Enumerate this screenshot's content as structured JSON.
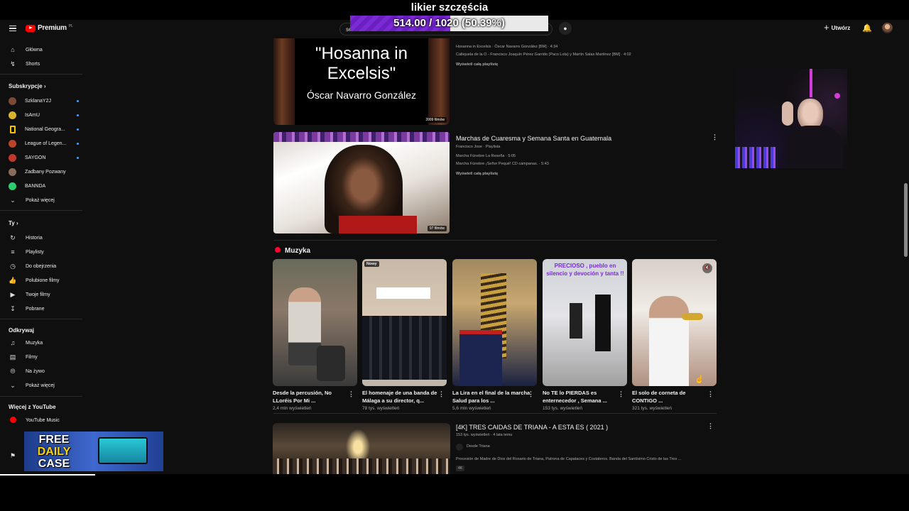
{
  "overlay": {
    "title": "likier szczęścia",
    "progress_text": "514.00 / 1020 (50.39%)",
    "progress_fraction": 0.5039
  },
  "header": {
    "logo_text": "Premium",
    "logo_country": "PL",
    "search_value": "se",
    "create_label": "Utwórz"
  },
  "sidebar": {
    "main": [
      {
        "label": "Główna",
        "icon": "home-icon"
      },
      {
        "label": "Shorts",
        "icon": "shorts-icon"
      }
    ],
    "subs_title": "Subskrypcje",
    "subs": [
      {
        "label": "SzklanaY2J",
        "color": "#7a4a35"
      },
      {
        "label": "IsAmU",
        "color": "#d8b32c"
      },
      {
        "label": "National Geogra...",
        "color": "#f5c400"
      },
      {
        "label": "League of Legen...",
        "color": "#b8452a"
      },
      {
        "label": "SAYGON",
        "color": "#c0392b"
      },
      {
        "label": "Zadbany Pozwany",
        "color": "#8b6b5a"
      },
      {
        "label": "BANNDA",
        "color": "#2ecc71"
      }
    ],
    "subs_more": "Pokaż więcej",
    "you_title": "Ty",
    "you": [
      {
        "label": "Historia",
        "icon": "history-icon"
      },
      {
        "label": "Playlisty",
        "icon": "playlists-icon"
      },
      {
        "label": "Do obejrzenia",
        "icon": "watch-later-icon"
      },
      {
        "label": "Polubione filmy",
        "icon": "like-icon"
      },
      {
        "label": "Twoje filmy",
        "icon": "your-videos-icon"
      },
      {
        "label": "Pobrane",
        "icon": "download-icon"
      }
    ],
    "explore_title": "Odkrywaj",
    "explore": [
      {
        "label": "Muzyka",
        "icon": "music-icon"
      },
      {
        "label": "Filmy",
        "icon": "movies-icon"
      },
      {
        "label": "Na żywo",
        "icon": "live-icon"
      }
    ],
    "explore_more": "Pokaż więcej",
    "more_title": "Więcej z YouTube",
    "more": [
      {
        "label": "YouTube Music",
        "icon": "youtube-music-icon"
      }
    ]
  },
  "playlists": [
    {
      "thumb_title_line1": "\"Hosanna in",
      "thumb_title_line2": "Excelsis\"",
      "thumb_author": "Óscar Navarro González",
      "count": "3999 filmów",
      "items": [
        "Hosanna in Excelsis · Óscar Navarro González [BM] · 4:34",
        "Callejuela de la O - Francisco Joaquín Pérez Garrido (Paco Lola) y Martín Salas Martínez [BM] · 4:02"
      ],
      "view_all": "Wyświetl całą playlistę"
    },
    {
      "title": "Marchas de Cuaresma y Semana Santa en Guatemala",
      "meta": "Francisco Jose · Playlista",
      "count": "97 filmów",
      "items": [
        "Marcha Fúnebre La Reseña · 5:05",
        "Marcha Fúnebre ¡Señor Pequé! CD campanas. · 5:43"
      ],
      "view_all": "Wyświetl całą playlistę"
    }
  ],
  "music_section": {
    "title": "Muzyka",
    "shorts": [
      {
        "title": "Desde la percusión, No LLoréis Por Mi ...",
        "views": "2,4 mln wyświetleń",
        "badge": ""
      },
      {
        "title": "El homenaje de una banda de Málaga a su director, q...",
        "views": "78 tys. wyświetleń",
        "badge": "Nowy"
      },
      {
        "title": "La Lira en el final de la marcha Salud para los ...",
        "views": "5,6 mln wyświetleń",
        "badge": ""
      },
      {
        "title": "No TE lo PIERDAS es enternecedor , Semana ...",
        "views": "153 tys. wyświetleń",
        "badge": ""
      },
      {
        "title": "El solo de corneta de CONTIGO ...",
        "views": "321 tys. wyświetleń",
        "badge": ""
      }
    ],
    "short4_overlay": "PRECIOSO , pueblo en silencio y devoción y tanta !!"
  },
  "video": {
    "title": "[4K] TRES CAIDAS DE TRIANA - A ESTA ES ( 2021 )",
    "meta": "153 tys. wyświetleń · 4 lata temu",
    "channel": "Desde Triana",
    "description": "Procesión de Madre de Dios del Rosario de Triana, Patrona de Capataces y Costaleros. Banda del Santísimo Cristo de las Tres ...",
    "badge": "4K"
  },
  "ad": {
    "line1": "FREE",
    "line2": "DAILY",
    "line3": "CASE"
  }
}
